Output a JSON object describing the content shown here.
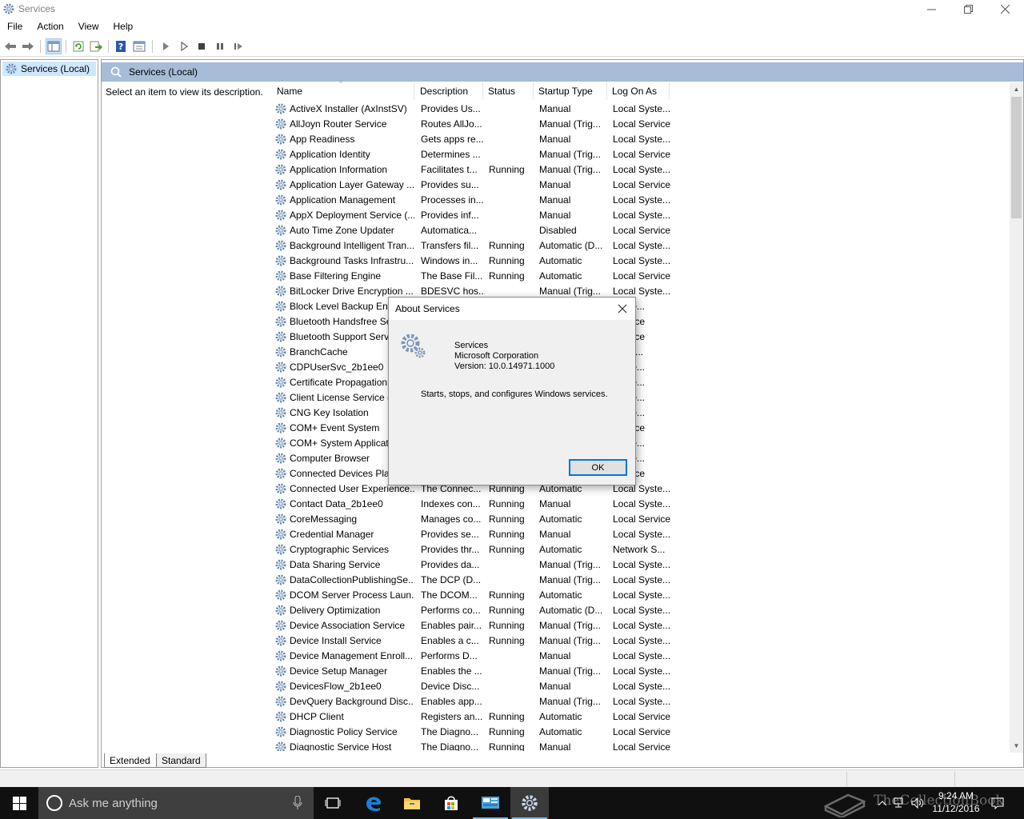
{
  "window": {
    "title": "Services"
  },
  "menu": [
    "File",
    "Action",
    "View",
    "Help"
  ],
  "tree": {
    "root_label": "Services (Local)"
  },
  "pane": {
    "header": "Services (Local)",
    "description_prompt": "Select an item to view its description."
  },
  "columns": [
    "Name",
    "Description",
    "Status",
    "Startup Type",
    "Log On As"
  ],
  "services": [
    {
      "name": "ActiveX Installer (AxInstSV)",
      "description": "Provides Us...",
      "status": "",
      "startup": "Manual",
      "logon": "Local Syste..."
    },
    {
      "name": "AllJoyn Router Service",
      "description": "Routes AllJo...",
      "status": "",
      "startup": "Manual (Trig...",
      "logon": "Local Service"
    },
    {
      "name": "App Readiness",
      "description": "Gets apps re...",
      "status": "",
      "startup": "Manual",
      "logon": "Local Syste..."
    },
    {
      "name": "Application Identity",
      "description": "Determines ...",
      "status": "",
      "startup": "Manual (Trig...",
      "logon": "Local Service"
    },
    {
      "name": "Application Information",
      "description": "Facilitates t...",
      "status": "Running",
      "startup": "Manual (Trig...",
      "logon": "Local Syste..."
    },
    {
      "name": "Application Layer Gateway ...",
      "description": "Provides su...",
      "status": "",
      "startup": "Manual",
      "logon": "Local Service"
    },
    {
      "name": "Application Management",
      "description": "Processes in...",
      "status": "",
      "startup": "Manual",
      "logon": "Local Syste..."
    },
    {
      "name": "AppX Deployment Service (...",
      "description": "Provides inf...",
      "status": "",
      "startup": "Manual",
      "logon": "Local Syste..."
    },
    {
      "name": "Auto Time Zone Updater",
      "description": "Automatica...",
      "status": "",
      "startup": "Disabled",
      "logon": "Local Service"
    },
    {
      "name": "Background Intelligent Tran...",
      "description": "Transfers fil...",
      "status": "Running",
      "startup": "Automatic (D...",
      "logon": "Local Syste..."
    },
    {
      "name": "Background Tasks Infrastru...",
      "description": "Windows in...",
      "status": "Running",
      "startup": "Automatic",
      "logon": "Local Syste..."
    },
    {
      "name": "Base Filtering Engine",
      "description": "The Base Fil...",
      "status": "Running",
      "startup": "Automatic",
      "logon": "Local Service"
    },
    {
      "name": "BitLocker Drive Encryption ...",
      "description": "BDESVC hos...",
      "status": "",
      "startup": "Manual (Trig...",
      "logon": "Local Syste..."
    },
    {
      "name": "Block Level Backup Eng",
      "description": "",
      "status": "",
      "startup": "",
      "logon": "Syste..."
    },
    {
      "name": "Bluetooth Handsfree Se",
      "description": "",
      "status": "",
      "startup": "",
      "logon": "Service"
    },
    {
      "name": "Bluetooth Support Servi",
      "description": "",
      "status": "",
      "startup": "",
      "logon": "Service"
    },
    {
      "name": "BranchCache",
      "description": "",
      "status": "",
      "startup": "",
      "logon": "ork S..."
    },
    {
      "name": "CDPUserSvc_2b1ee0",
      "description": "",
      "status": "",
      "startup": "",
      "logon": "Syste..."
    },
    {
      "name": "Certificate Propagation",
      "description": "",
      "status": "",
      "startup": "",
      "logon": "Syste..."
    },
    {
      "name": "Client License Service (C",
      "description": "",
      "status": "",
      "startup": "",
      "logon": "Syste..."
    },
    {
      "name": "CNG Key Isolation",
      "description": "",
      "status": "",
      "startup": "",
      "logon": "Syste..."
    },
    {
      "name": "COM+ Event System",
      "description": "",
      "status": "",
      "startup": "",
      "logon": "Service"
    },
    {
      "name": "COM+ System Applicat",
      "description": "",
      "status": "",
      "startup": "",
      "logon": "Syste..."
    },
    {
      "name": "Computer Browser",
      "description": "",
      "status": "",
      "startup": "",
      "logon": "Syste..."
    },
    {
      "name": "Connected Devices Plat",
      "description": "",
      "status": "",
      "startup": "",
      "logon": "Service"
    },
    {
      "name": "Connected User Experience...",
      "description": "The Connec...",
      "status": "Running",
      "startup": "Automatic",
      "logon": "Local Syste..."
    },
    {
      "name": "Contact Data_2b1ee0",
      "description": "Indexes con...",
      "status": "Running",
      "startup": "Manual",
      "logon": "Local Syste..."
    },
    {
      "name": "CoreMessaging",
      "description": "Manages co...",
      "status": "Running",
      "startup": "Automatic",
      "logon": "Local Service"
    },
    {
      "name": "Credential Manager",
      "description": "Provides se...",
      "status": "Running",
      "startup": "Manual",
      "logon": "Local Syste..."
    },
    {
      "name": "Cryptographic Services",
      "description": "Provides thr...",
      "status": "Running",
      "startup": "Automatic",
      "logon": "Network S..."
    },
    {
      "name": "Data Sharing Service",
      "description": "Provides da...",
      "status": "",
      "startup": "Manual (Trig...",
      "logon": "Local Syste..."
    },
    {
      "name": "DataCollectionPublishingSe...",
      "description": "The DCP (D...",
      "status": "",
      "startup": "Manual (Trig...",
      "logon": "Local Syste..."
    },
    {
      "name": "DCOM Server Process Laun...",
      "description": "The DCOM...",
      "status": "Running",
      "startup": "Automatic",
      "logon": "Local Syste..."
    },
    {
      "name": "Delivery Optimization",
      "description": "Performs co...",
      "status": "Running",
      "startup": "Automatic (D...",
      "logon": "Local Syste..."
    },
    {
      "name": "Device Association Service",
      "description": "Enables pair...",
      "status": "Running",
      "startup": "Manual (Trig...",
      "logon": "Local Syste..."
    },
    {
      "name": "Device Install Service",
      "description": "Enables a c...",
      "status": "Running",
      "startup": "Manual (Trig...",
      "logon": "Local Syste..."
    },
    {
      "name": "Device Management Enroll...",
      "description": "Performs D...",
      "status": "",
      "startup": "Manual",
      "logon": "Local Syste..."
    },
    {
      "name": "Device Setup Manager",
      "description": "Enables the ...",
      "status": "",
      "startup": "Manual (Trig...",
      "logon": "Local Syste..."
    },
    {
      "name": "DevicesFlow_2b1ee0",
      "description": "Device Disc...",
      "status": "",
      "startup": "Manual",
      "logon": "Local Syste..."
    },
    {
      "name": "DevQuery Background Disc...",
      "description": "Enables app...",
      "status": "",
      "startup": "Manual (Trig...",
      "logon": "Local Syste..."
    },
    {
      "name": "DHCP Client",
      "description": "Registers an...",
      "status": "Running",
      "startup": "Automatic",
      "logon": "Local Service"
    },
    {
      "name": "Diagnostic Policy Service",
      "description": "The Diagno...",
      "status": "Running",
      "startup": "Automatic",
      "logon": "Local Service"
    },
    {
      "name": "Diagnostic Service Host",
      "description": "The Diagno...",
      "status": "Running",
      "startup": "Manual",
      "logon": "Local Service"
    }
  ],
  "tabs": [
    "Extended",
    "Standard"
  ],
  "dialog": {
    "title": "About Services",
    "product": "Services",
    "company": "Microsoft Corporation",
    "version": "Version: 10.0.14971.1000",
    "description": "Starts, stops, and configures Windows services.",
    "ok_label": "OK"
  },
  "taskbar": {
    "search_placeholder": "Ask me anything",
    "time": "9:24 AM",
    "date": "11/12/2016",
    "watermark": "TheCollectionBook"
  },
  "icons": {
    "app": "gear-icon",
    "accent": "#0078d7",
    "header_band": "#a6bcd7"
  }
}
